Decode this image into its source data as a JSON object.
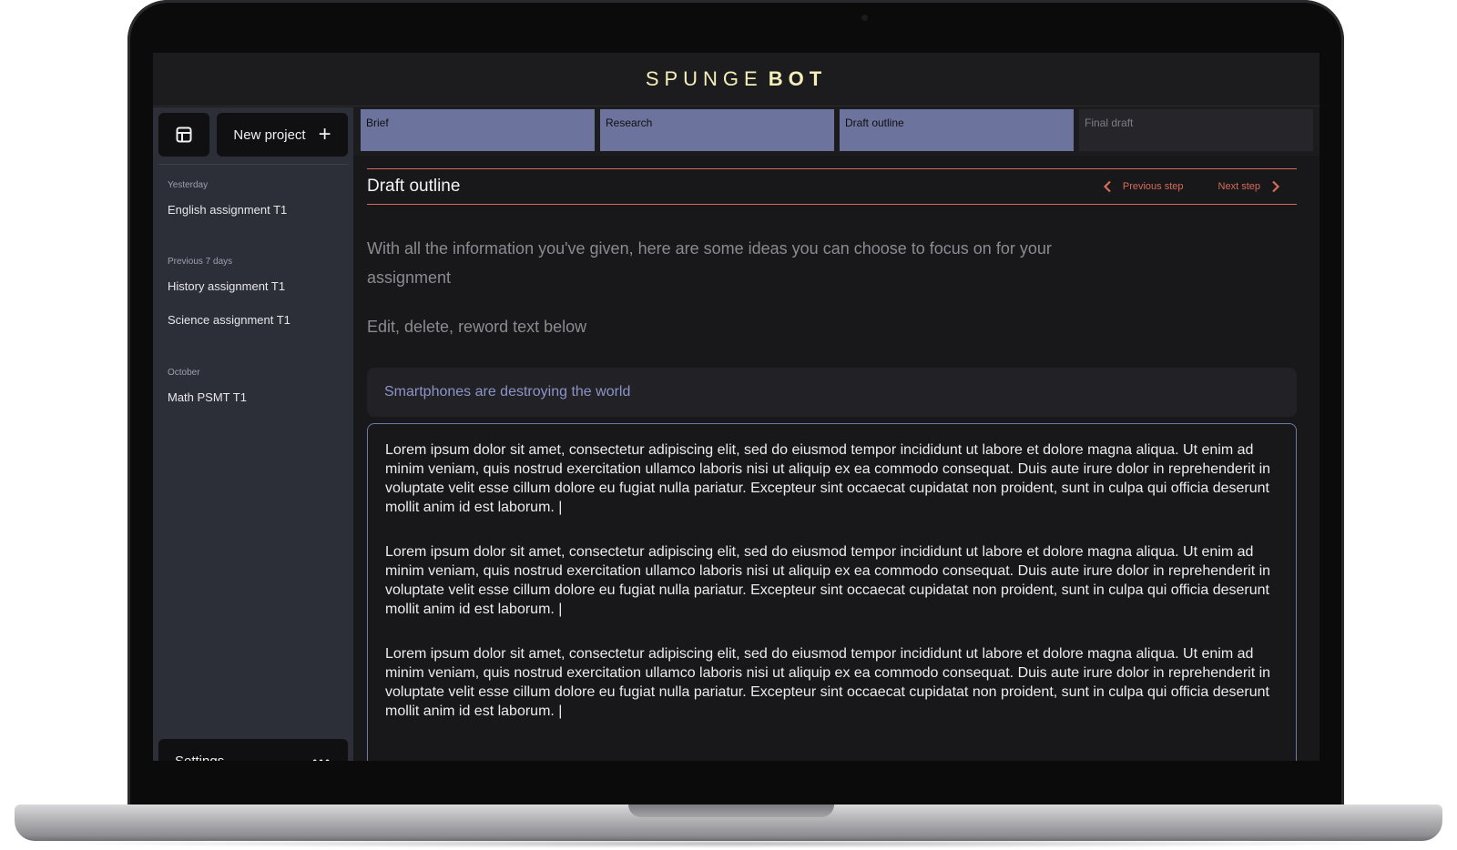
{
  "brand": {
    "part1": "SPUNGE",
    "part2": "BOT"
  },
  "sidebar": {
    "new_project_label": "New project",
    "groups": [
      {
        "heading": "Yesterday",
        "items": [
          "English assignment T1"
        ]
      },
      {
        "heading": "Previous 7 days",
        "items": [
          "History assignment T1",
          "Science assignment T1"
        ]
      },
      {
        "heading": "October",
        "items": [
          "Math PSMT T1"
        ]
      }
    ],
    "settings_label": "Settings"
  },
  "tabs": [
    {
      "label": "Brief",
      "state": "done"
    },
    {
      "label": "Research",
      "state": "done"
    },
    {
      "label": "Draft outline",
      "state": "done"
    },
    {
      "label": "Final draft",
      "state": "todo"
    }
  ],
  "step": {
    "title": "Draft outline",
    "previous_label": "Previous step",
    "next_label": "Next step",
    "intro": "With all the information you've given, here are some ideas you can choose to focus on for your assignment",
    "hint": "Edit, delete, reword text below",
    "topic": "Smartphones are destroying the world",
    "paragraphs": [
      "Lorem ipsum dolor sit amet, consectetur adipiscing elit, sed do eiusmod tempor incididunt ut labore et dolore magna aliqua. Ut enim ad minim veniam, quis nostrud exercitation ullamco laboris nisi ut aliquip ex ea commodo consequat. Duis aute irure dolor in reprehenderit in voluptate velit esse cillum dolore eu fugiat nulla pariatur. Excepteur sint occaecat cupidatat non proident, sunt in culpa qui officia deserunt mollit anim id est laborum.",
      "Lorem ipsum dolor sit amet, consectetur adipiscing elit, sed do eiusmod tempor incididunt ut labore et dolore magna aliqua. Ut enim ad minim veniam, quis nostrud exercitation ullamco laboris nisi ut aliquip ex ea commodo consequat. Duis aute irure dolor in reprehenderit in voluptate velit esse cillum dolore eu fugiat nulla pariatur. Excepteur sint occaecat cupidatat non proident, sunt in culpa qui officia deserunt mollit anim id est laborum.",
      "Lorem ipsum dolor sit amet, consectetur adipiscing elit, sed do eiusmod tempor incididunt ut labore et dolore magna aliqua. Ut enim ad minim veniam, quis nostrud exercitation ullamco laboris nisi ut aliquip ex ea commodo consequat. Duis aute irure dolor in reprehenderit in voluptate velit esse cillum dolore eu fugiat nulla pariatur. Excepteur sint occaecat cupidatat non proident, sunt in culpa qui officia deserunt mollit anim id est laborum."
    ]
  },
  "icons": {
    "layout": "layout-grid-icon",
    "plus": "plus-icon",
    "more": "more-dots-icon",
    "prev": "chevron-left-icon",
    "next": "chevron-right-icon"
  },
  "colors": {
    "brand": "#f4efb9",
    "accent": "#d76b59",
    "tab_done": "#6c739c",
    "topic_text": "#8c93c8",
    "sidebar_bg": "#2c2f38"
  }
}
